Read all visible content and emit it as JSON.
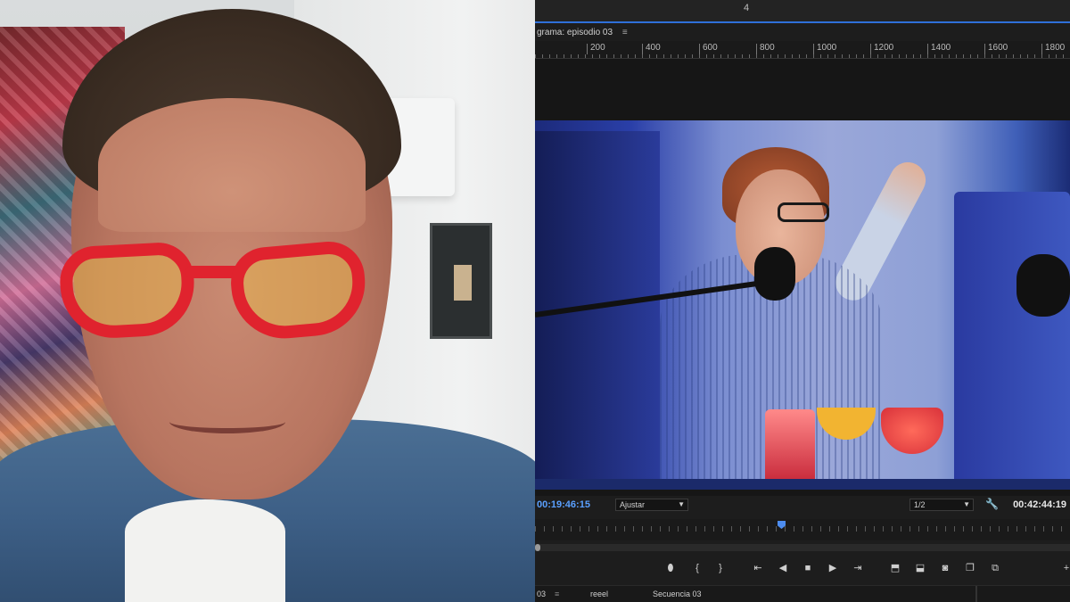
{
  "editor": {
    "tab_number": "4",
    "program_panel_title": "grama: episodio 03",
    "panel_menu_icon": "hamburger-menu-icon",
    "ruler_ticks": [
      "200",
      "400",
      "600",
      "800",
      "1000",
      "1200",
      "1400",
      "1600",
      "1800"
    ],
    "timecode_current": "00:19:46:15",
    "fit_dropdown": "Ajustar",
    "resolution_dropdown": "1/2",
    "timecode_duration": "00:42:44:19",
    "playhead_fraction": 0.46,
    "transport_buttons": [
      {
        "name": "add-marker",
        "glyph": "⬮"
      },
      {
        "name": "mark-in",
        "glyph": "{"
      },
      {
        "name": "mark-out",
        "glyph": "}"
      },
      {
        "name": "go-to-in",
        "glyph": "⇤"
      },
      {
        "name": "step-back",
        "glyph": "◀"
      },
      {
        "name": "stop",
        "glyph": "■"
      },
      {
        "name": "step-forward",
        "glyph": "▶"
      },
      {
        "name": "go-to-out",
        "glyph": "⇥"
      },
      {
        "name": "lift",
        "glyph": "⬒"
      },
      {
        "name": "extract",
        "glyph": "⬓"
      },
      {
        "name": "export-frame",
        "glyph": "◙"
      },
      {
        "name": "comparison-view",
        "glyph": "❐"
      },
      {
        "name": "safe-margins",
        "glyph": "⧉"
      },
      {
        "name": "add-button",
        "glyph": "+"
      }
    ],
    "bottom_tabs": [
      "03",
      "reeel",
      "Secuencia 03"
    ],
    "accent_color": "#2f6fd8",
    "timecode_color": "#5aa0ff"
  }
}
